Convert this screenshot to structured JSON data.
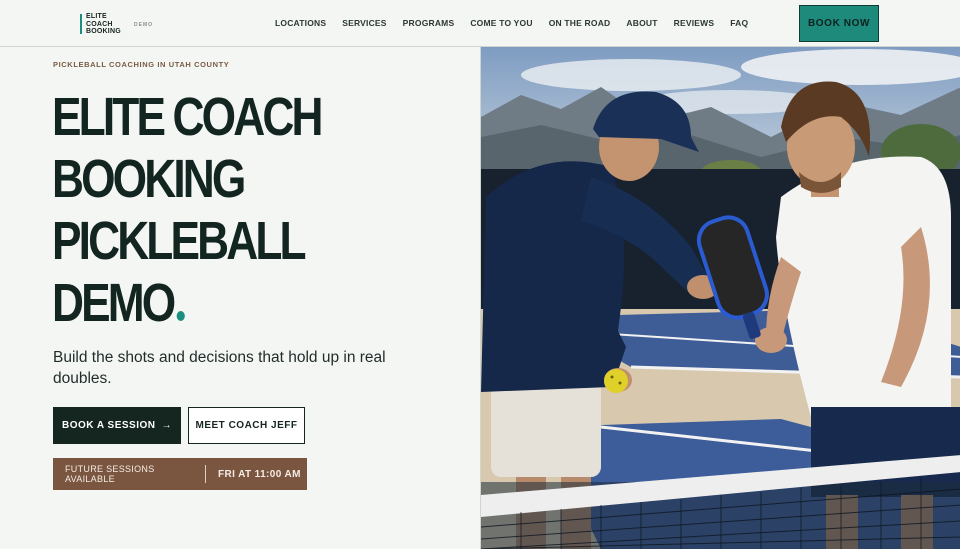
{
  "header": {
    "logo_lines": [
      "ELITE",
      "COACH",
      "BOOKING"
    ],
    "logo_tag": "DEMO",
    "nav": [
      "LOCATIONS",
      "SERVICES",
      "PROGRAMS",
      "COME TO YOU",
      "ON THE ROAD",
      "ABOUT",
      "REVIEWS",
      "FAQ"
    ],
    "cta": "BOOK NOW"
  },
  "hero": {
    "eyebrow": "PICKLEBALL COACHING IN UTAH COUNTY",
    "headline": [
      "ELITE COACH",
      "BOOKING",
      "PICKLEBALL",
      "DEMO"
    ],
    "subtext": "Build the shots and decisions that hold up in real doubles.",
    "primary_button": "BOOK A SESSION",
    "primary_arrow": "→",
    "secondary_button": "MEET COACH JEFF",
    "status_left": "FUTURE SESSIONS AVAILABLE",
    "status_right": "FRI AT 11:00 AM",
    "image_icon": "coaching-photo"
  },
  "colors": {
    "accent": "#1a8f7f",
    "dark": "#15251f",
    "brown": "#7a5540",
    "background": "#f4f6f4"
  }
}
